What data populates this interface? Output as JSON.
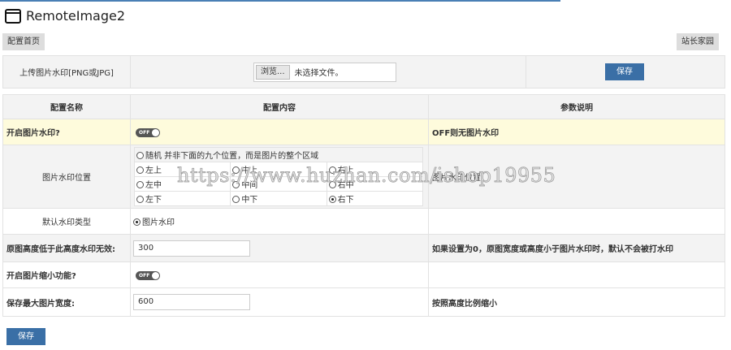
{
  "header": {
    "title": "RemoteImage2",
    "home_button": "配置首页",
    "site_button": "站长家园"
  },
  "upload": {
    "label": "上传图片水印[PNG或JPG]",
    "browse": "浏览...",
    "no_file": "未选择文件。",
    "save": "保存"
  },
  "table": {
    "headers": [
      "配置名称",
      "配置内容",
      "参数说明"
    ],
    "rows": {
      "watermark_on": {
        "name": "开启图片水印?",
        "toggle": "OFF",
        "desc": "OFF则无图片水印"
      },
      "position": {
        "name": "图片水印位置",
        "random": "随机  并非下面的九个位置，而是图片的整个区域",
        "options": [
          "左上",
          "中上",
          "右上",
          "左中",
          "中间",
          "右中",
          "左下",
          "中下",
          "右下"
        ],
        "selected": "右下",
        "desc": "图片水印位置"
      },
      "type": {
        "name": "默认水印类型",
        "option": "图片水印"
      },
      "min_height": {
        "name": "原图高度低于此高度水印无效:",
        "value": "300",
        "desc": "如果设置为0，原图宽度或高度小于图片水印时，默认不会被打水印"
      },
      "shrink": {
        "name": "开启图片缩小功能?",
        "toggle": "OFF"
      },
      "max_width": {
        "name": "保存最大图片宽度:",
        "value": "600",
        "desc": "按照高度比例缩小"
      }
    }
  },
  "footer": {
    "save": "保存"
  },
  "watermark_overlay": "https://www.huzhan.com/ishop19955"
}
